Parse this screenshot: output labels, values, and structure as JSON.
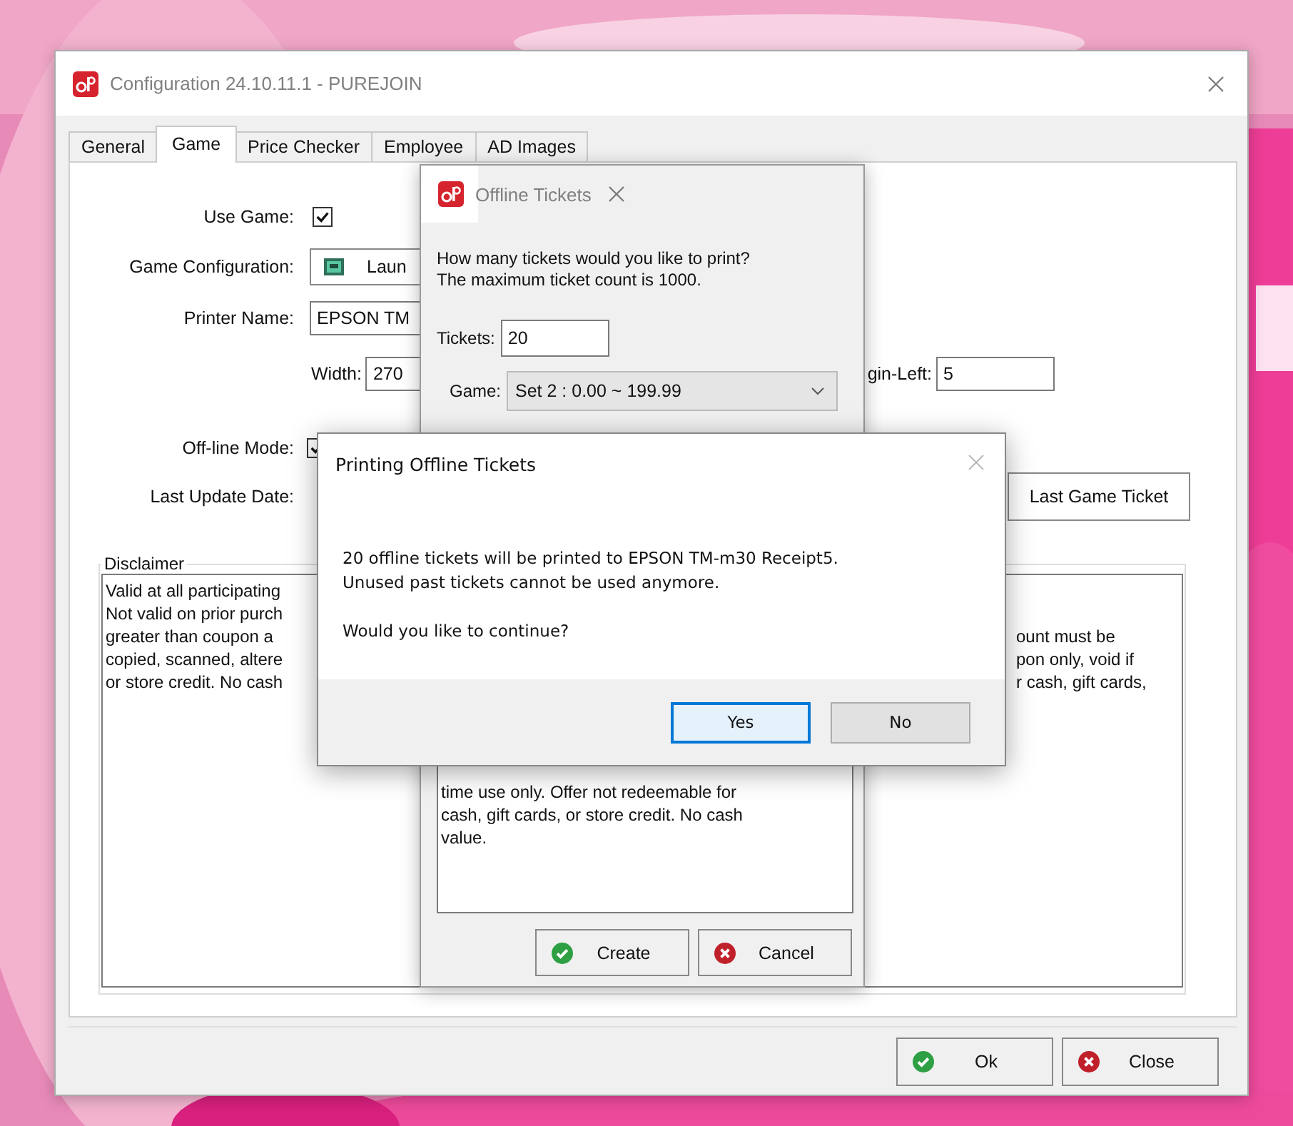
{
  "config_window": {
    "title": "Configuration 24.10.11.1  - PUREJOIN",
    "tabs": [
      {
        "label": "General",
        "selected": false
      },
      {
        "label": "Game",
        "selected": true
      },
      {
        "label": "Price Checker",
        "selected": false
      },
      {
        "label": "Employee",
        "selected": false
      },
      {
        "label": "AD Images",
        "selected": false
      }
    ],
    "use_game": {
      "label": "Use Game:",
      "checked": true
    },
    "game_configuration": {
      "label": "Game Configuration:",
      "value": "Laun"
    },
    "printer_name": {
      "label": "Printer Name:",
      "value": "EPSON TM"
    },
    "width": {
      "label": "Width:",
      "value": "270"
    },
    "margin_left": {
      "label": "gin-Left:",
      "value": "5"
    },
    "offline_mode": {
      "label": "Off-line Mode:",
      "checked": true
    },
    "last_update_date": {
      "label": "Last Update Date:"
    },
    "last_game_ticket_button": "Last Game Ticket",
    "disclaimer": {
      "title": "Disclaimer",
      "left_lines": [
        "Valid at all participating",
        "Not valid on prior purch",
        "greater than coupon a",
        "copied, scanned, altere",
        "or store credit. No cash"
      ],
      "right_lines": [
        "ount must be",
        "pon only, void if",
        "r cash, gift cards,"
      ]
    },
    "buttons": [
      {
        "label": "Ok",
        "kind": "ok"
      },
      {
        "label": "Close",
        "kind": "close"
      }
    ]
  },
  "offline_tickets_dialog": {
    "title": "Offline Tickets",
    "prompt_lines": [
      "How many tickets would you like to print?",
      "The maximum ticket count is 1000."
    ],
    "tickets": {
      "label": "Tickets:",
      "value": "20"
    },
    "game": {
      "label": "Game:",
      "value": "Set 2 : 0.00 ~ 199.99"
    },
    "disclaimer_lines": [
      "time use only. Offer not redeemable for",
      "cash, gift cards, or store credit. No cash",
      "value."
    ],
    "buttons": [
      {
        "label": "Create",
        "kind": "ok"
      },
      {
        "label": "Cancel",
        "kind": "close"
      }
    ]
  },
  "confirm_dialog": {
    "title": "Printing Offline Tickets",
    "message_lines": [
      "20 offline tickets will be printed to EPSON TM-m30 Receipt5.",
      "Unused past tickets cannot be used anymore."
    ],
    "question": "Would you like to continue?",
    "buttons": [
      {
        "label": "Yes",
        "selected": true
      },
      {
        "label": "No",
        "selected": false
      }
    ]
  }
}
